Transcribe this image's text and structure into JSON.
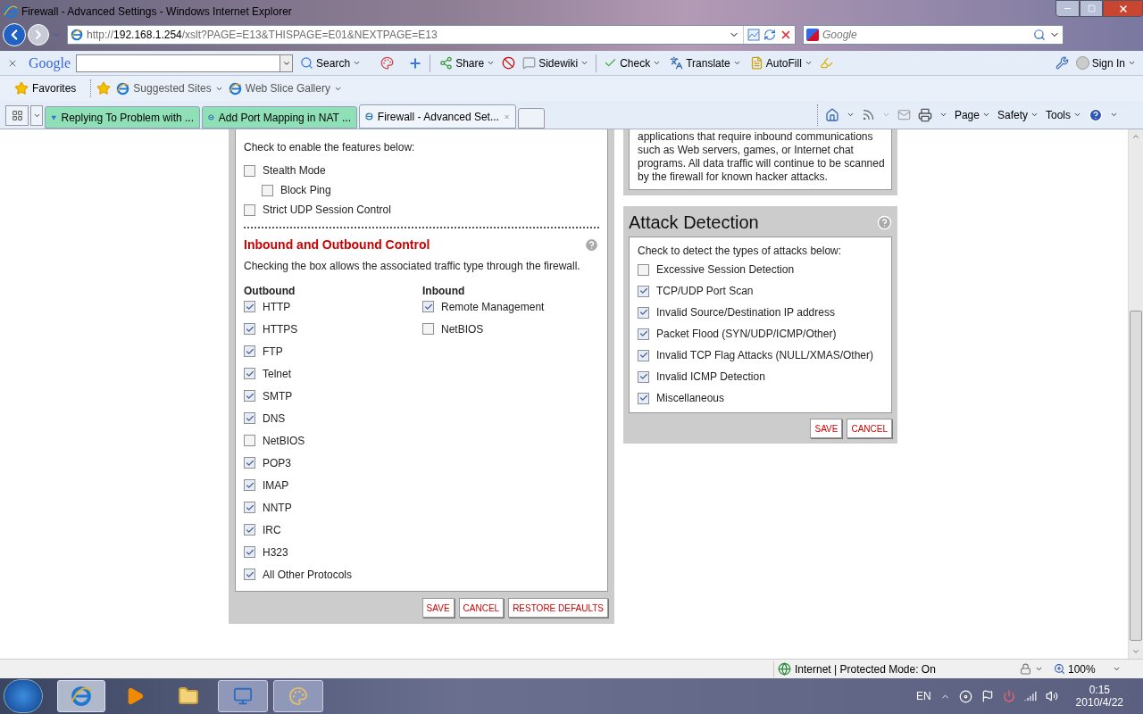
{
  "window": {
    "title": "Firewall - Advanced Settings - Windows Internet Explorer"
  },
  "address_bar": {
    "scheme": "http://",
    "host": "192.168.1.254",
    "path": "/xslt?PAGE=E13&THISPAGE=E01&NEXTPAGE=E13"
  },
  "search_box": {
    "placeholder": "Google"
  },
  "google_toolbar": {
    "brand": "Google",
    "items": [
      {
        "label": "Search",
        "kind": "search"
      },
      {
        "label": "Share",
        "kind": "share"
      },
      {
        "label": "Sidewiki",
        "kind": "sidewiki"
      },
      {
        "label": "Check",
        "kind": "check"
      },
      {
        "label": "Translate",
        "kind": "translate"
      },
      {
        "label": "AutoFill",
        "kind": "autofill"
      }
    ],
    "sign_in": "Sign In"
  },
  "favorites_bar": {
    "favorites": "Favorites",
    "items": [
      "Suggested Sites",
      "Web Slice Gallery"
    ]
  },
  "tabs": [
    {
      "label": "Replying To Problem with ...",
      "selected": false,
      "kind": "forum"
    },
    {
      "label": "Add Port Mapping in NAT ...",
      "selected": false,
      "kind": "ie"
    },
    {
      "label": "Firewall - Advanced Set...",
      "selected": true,
      "kind": "ie"
    }
  ],
  "command_bar": [
    "Page",
    "Safety",
    "Tools"
  ],
  "features": {
    "intro": "Check to enable the features below:",
    "items": [
      {
        "label": "Stealth Mode",
        "checked": false,
        "children": [
          {
            "label": "Block Ping",
            "checked": false
          }
        ]
      },
      {
        "label": "Strict UDP Session Control",
        "checked": false
      }
    ]
  },
  "traffic_control": {
    "title": "Inbound and Outbound Control",
    "description": "Checking the box allows the associated traffic type through the firewall.",
    "outbound": {
      "heading": "Outbound",
      "items": [
        {
          "label": "HTTP",
          "checked": true
        },
        {
          "label": "HTTPS",
          "checked": true
        },
        {
          "label": "FTP",
          "checked": true
        },
        {
          "label": "Telnet",
          "checked": true
        },
        {
          "label": "SMTP",
          "checked": true
        },
        {
          "label": "DNS",
          "checked": true
        },
        {
          "label": "NetBIOS",
          "checked": false
        },
        {
          "label": "POP3",
          "checked": true
        },
        {
          "label": "IMAP",
          "checked": true
        },
        {
          "label": "NNTP",
          "checked": true
        },
        {
          "label": "IRC",
          "checked": true
        },
        {
          "label": "H323",
          "checked": true
        },
        {
          "label": "All Other Protocols",
          "checked": true
        }
      ]
    },
    "inbound": {
      "heading": "Inbound",
      "items": [
        {
          "label": "Remote Management",
          "checked": true
        },
        {
          "label": "NetBIOS",
          "checked": false
        }
      ]
    },
    "buttons": [
      "SAVE",
      "CANCEL",
      "RESTORE DEFAULTS"
    ]
  },
  "info_text": "applications that require inbound communications such as Web servers, games, or Internet chat programs. All data traffic will continue to be scanned by the firewall for known hacker attacks.",
  "attack_detection": {
    "title": "Attack Detection",
    "intro": "Check to detect the types of attacks below:",
    "items": [
      {
        "label": "Excessive Session Detection",
        "checked": false
      },
      {
        "label": "TCP/UDP Port Scan",
        "checked": true
      },
      {
        "label": "Invalid Source/Destination IP address",
        "checked": true
      },
      {
        "label": "Packet Flood (SYN/UDP/ICMP/Other)",
        "checked": true
      },
      {
        "label": "Invalid TCP Flag Attacks (NULL/XMAS/Other)",
        "checked": true
      },
      {
        "label": "Invalid ICMP Detection",
        "checked": true
      },
      {
        "label": "Miscellaneous",
        "checked": true
      }
    ],
    "buttons": [
      "SAVE",
      "CANCEL"
    ]
  },
  "status_bar": {
    "zone": "Internet | Protected Mode: On",
    "zoom": "100%"
  },
  "taskbar": {
    "language": "EN",
    "time": "0:15",
    "date": "2010/4/22"
  }
}
